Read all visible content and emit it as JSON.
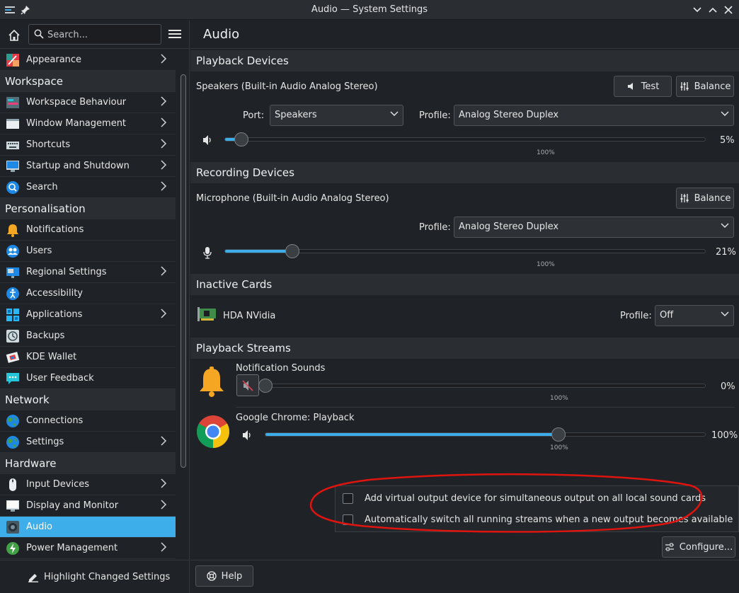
{
  "window": {
    "title": "Audio — System Settings"
  },
  "sidebar": {
    "search_placeholder": "Search...",
    "items": [
      {
        "kind": "item",
        "label": "Appearance",
        "icon": "appearance-icon",
        "chevron": true
      },
      {
        "kind": "cat",
        "label": "Workspace"
      },
      {
        "kind": "item",
        "label": "Workspace Behaviour",
        "icon": "workspace-icon",
        "chevron": true
      },
      {
        "kind": "item",
        "label": "Window Management",
        "icon": "window-icon",
        "chevron": true
      },
      {
        "kind": "item",
        "label": "Shortcuts",
        "icon": "keyboard-icon",
        "chevron": true
      },
      {
        "kind": "item",
        "label": "Startup and Shutdown",
        "icon": "startup-icon",
        "chevron": true
      },
      {
        "kind": "item",
        "label": "Search",
        "icon": "search-icon",
        "chevron": true
      },
      {
        "kind": "cat",
        "label": "Personalisation"
      },
      {
        "kind": "item",
        "label": "Notifications",
        "icon": "bell-icon",
        "chevron": false
      },
      {
        "kind": "item",
        "label": "Users",
        "icon": "users-icon",
        "chevron": false
      },
      {
        "kind": "item",
        "label": "Regional Settings",
        "icon": "flag-icon",
        "chevron": true
      },
      {
        "kind": "item",
        "label": "Accessibility",
        "icon": "accessibility-icon",
        "chevron": false
      },
      {
        "kind": "item",
        "label": "Applications",
        "icon": "applications-icon",
        "chevron": true
      },
      {
        "kind": "item",
        "label": "Backups",
        "icon": "backup-icon",
        "chevron": false
      },
      {
        "kind": "item",
        "label": "KDE Wallet",
        "icon": "wallet-icon",
        "chevron": false
      },
      {
        "kind": "item",
        "label": "User Feedback",
        "icon": "feedback-icon",
        "chevron": false
      },
      {
        "kind": "cat",
        "label": "Network"
      },
      {
        "kind": "item",
        "label": "Connections",
        "icon": "globe-icon",
        "chevron": false
      },
      {
        "kind": "item",
        "label": "Settings",
        "icon": "globe-settings-icon",
        "chevron": true
      },
      {
        "kind": "cat",
        "label": "Hardware"
      },
      {
        "kind": "item",
        "label": "Input Devices",
        "icon": "mouse-icon",
        "chevron": true
      },
      {
        "kind": "item",
        "label": "Display and Monitor",
        "icon": "monitor-icon",
        "chevron": true
      },
      {
        "kind": "item",
        "label": "Audio",
        "icon": "speaker-icon",
        "chevron": false,
        "active": true
      },
      {
        "kind": "item",
        "label": "Power Management",
        "icon": "power-icon",
        "chevron": true
      }
    ],
    "highlight_label": "Highlight Changed Settings"
  },
  "main": {
    "title": "Audio",
    "playback": {
      "section": "Playback Devices",
      "device": "Speakers (Built-in Audio Analog Stereo)",
      "test_label": "Test",
      "balance_label": "Balance",
      "port_label": "Port:",
      "port_value": "Speakers",
      "profile_label": "Profile:",
      "profile_value": "Analog Stereo Duplex",
      "volume_pct": "5%",
      "volume": 5,
      "mark": "100%"
    },
    "recording": {
      "section": "Recording Devices",
      "device": "Microphone (Built-in Audio Analog Stereo)",
      "balance_label": "Balance",
      "profile_label": "Profile:",
      "profile_value": "Analog Stereo Duplex",
      "volume_pct": "21%",
      "volume": 21,
      "mark": "100%"
    },
    "inactive": {
      "section": "Inactive Cards",
      "card": "HDA NVidia",
      "profile_label": "Profile:",
      "profile_value": "Off"
    },
    "streams": {
      "section": "Playback Streams",
      "items": [
        {
          "name": "Notification Sounds",
          "volume_pct": "0%",
          "volume": 0,
          "mark": "100%",
          "muted": true
        },
        {
          "name": "Google Chrome: Playback",
          "volume_pct": "100%",
          "volume": 100,
          "mark": "100%",
          "muted": false
        }
      ]
    },
    "options": {
      "virtual_output": "Add virtual output device for simultaneous output on all local sound cards",
      "auto_switch": "Automatically switch all running streams when a new output becomes available"
    },
    "configure_label": "Configure...",
    "help_label": "Help"
  }
}
